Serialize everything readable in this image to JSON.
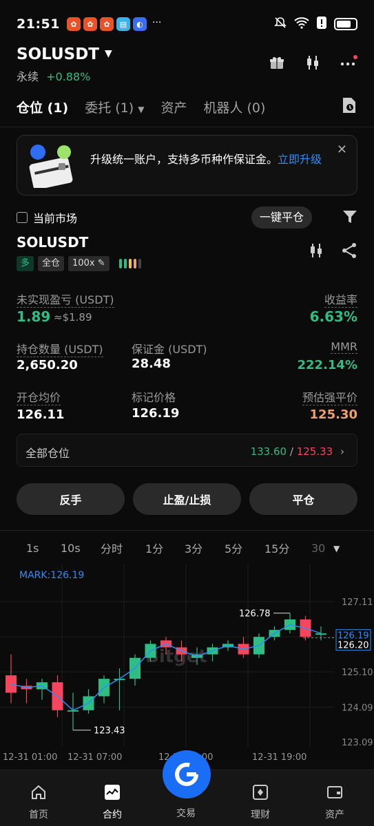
{
  "status": {
    "time": "21:51",
    "ellipsis": "···"
  },
  "header": {
    "symbol": "SOLUSDT",
    "type": "永续",
    "change": "+0.88%"
  },
  "tabs": [
    {
      "label": "仓位 (1)"
    },
    {
      "label": "委托 (1)"
    },
    {
      "label": "资产"
    },
    {
      "label": "机器人 (0)"
    }
  ],
  "banner": {
    "text": "升级统一账户，支持多币种作保证金。",
    "link": "立即升级"
  },
  "filter": {
    "label": "当前市场",
    "close_all": "一键平仓"
  },
  "position": {
    "symbol": "SOLUSDT",
    "side": "多",
    "margin_mode": "全仓",
    "leverage": "100x",
    "unrealized_label": "未实现盈亏 (USDT)",
    "unrealized_value": "1.89",
    "unrealized_usd": "≈$1.89",
    "roe_label": "收益率",
    "roe_value": "6.63%",
    "qty_label": "持仓数量 (USDT)",
    "qty_value": "2,650.20",
    "margin_label": "保证金 (USDT)",
    "margin_value": "28.48",
    "mmr_label": "MMR",
    "mmr_value": "222.14%",
    "entry_label": "开仓均价",
    "entry_value": "126.11",
    "mark_label": "标记价格",
    "mark_value": "126.19",
    "liq_label": "预估强平价",
    "liq_value": "125.30"
  },
  "all_positions": {
    "label": "全部仓位",
    "tp": "133.60",
    "sep": "/",
    "sl": "125.33"
  },
  "actions": {
    "reverse": "反手",
    "tpsl": "止盈/止损",
    "close": "平仓"
  },
  "intervals": [
    "1s",
    "10s",
    "分时",
    "1分",
    "3分",
    "5分",
    "15分",
    "30"
  ],
  "chart_data": {
    "type": "candlestick",
    "mark_label": "MARK:126.19",
    "y_ticks": [
      "127.11",
      "126.19",
      "126.20",
      "125.10",
      "124.09",
      "123.09"
    ],
    "x_ticks": [
      "12-31 01:00",
      "12-31 07:00",
      "12-31 13:00",
      "12-31 19:00"
    ],
    "high_label": "126.78",
    "low_label": "123.43",
    "ylim": [
      123.09,
      127.11
    ],
    "candles": [
      {
        "o": 125.0,
        "h": 125.6,
        "l": 124.2,
        "c": 124.5
      },
      {
        "o": 124.7,
        "h": 124.9,
        "l": 124.2,
        "c": 124.6
      },
      {
        "o": 124.6,
        "h": 124.9,
        "l": 124.3,
        "c": 124.8
      },
      {
        "o": 124.8,
        "h": 125.0,
        "l": 123.8,
        "c": 124.0
      },
      {
        "o": 124.0,
        "h": 124.5,
        "l": 123.43,
        "c": 124.0
      },
      {
        "o": 124.0,
        "h": 124.6,
        "l": 123.9,
        "c": 124.4
      },
      {
        "o": 124.4,
        "h": 125.0,
        "l": 124.2,
        "c": 124.9
      },
      {
        "o": 124.9,
        "h": 125.2,
        "l": 124.0,
        "c": 124.9
      },
      {
        "o": 124.9,
        "h": 125.6,
        "l": 124.7,
        "c": 125.5
      },
      {
        "o": 125.5,
        "h": 126.0,
        "l": 125.4,
        "c": 125.9
      },
      {
        "o": 126.0,
        "h": 126.1,
        "l": 125.6,
        "c": 125.8
      },
      {
        "o": 125.8,
        "h": 126.0,
        "l": 125.4,
        "c": 125.6
      },
      {
        "o": 125.5,
        "h": 125.8,
        "l": 125.3,
        "c": 125.6
      },
      {
        "o": 125.6,
        "h": 125.9,
        "l": 125.4,
        "c": 125.8
      },
      {
        "o": 125.8,
        "h": 126.0,
        "l": 125.7,
        "c": 125.9
      },
      {
        "o": 125.9,
        "h": 126.1,
        "l": 125.5,
        "c": 125.6
      },
      {
        "o": 125.6,
        "h": 126.2,
        "l": 125.5,
        "c": 126.1
      },
      {
        "o": 126.1,
        "h": 126.4,
        "l": 126.0,
        "c": 126.3
      },
      {
        "o": 126.3,
        "h": 126.78,
        "l": 126.2,
        "c": 126.6
      },
      {
        "o": 126.6,
        "h": 126.7,
        "l": 126.0,
        "c": 126.1
      },
      {
        "o": 126.2,
        "h": 126.4,
        "l": 126.0,
        "c": 126.2
      }
    ],
    "colors": {
      "up": "#2ebd85",
      "down": "#f6465d",
      "ma": "#2f8df5"
    }
  },
  "nav": [
    {
      "label": "首页"
    },
    {
      "label": "合约"
    },
    {
      "label": "交易"
    },
    {
      "label": "理财"
    },
    {
      "label": "资产"
    }
  ]
}
